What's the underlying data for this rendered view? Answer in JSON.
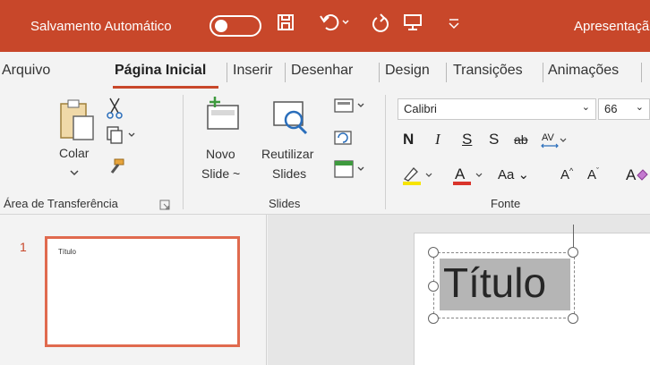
{
  "titlebar": {
    "autosave_label": "Salvamento Automático",
    "document_title": "Apresentação"
  },
  "tabs": [
    {
      "label": "Arquivo"
    },
    {
      "label": "Página Inicial"
    },
    {
      "label": "Inserir"
    },
    {
      "label": "Desenhar"
    },
    {
      "label": "Design"
    },
    {
      "label": "Transições"
    },
    {
      "label": "Animações"
    }
  ],
  "ribbon": {
    "clipboard": {
      "paste_label": "Colar",
      "group_label": "Área de Transferência"
    },
    "slides": {
      "new_slide_label": "Novo",
      "new_slide_label2": "Slide ~",
      "reuse_label": "Reutilizar",
      "reuse_label2": "Slides",
      "group_label": "Slides"
    },
    "font": {
      "font_name": "Calibri",
      "font_size": "66",
      "group_label": "Fonte",
      "aa_label": "Aa"
    }
  },
  "thumbnails": [
    {
      "number": "1",
      "title": "Título"
    }
  ],
  "slide": {
    "title": "Título"
  }
}
